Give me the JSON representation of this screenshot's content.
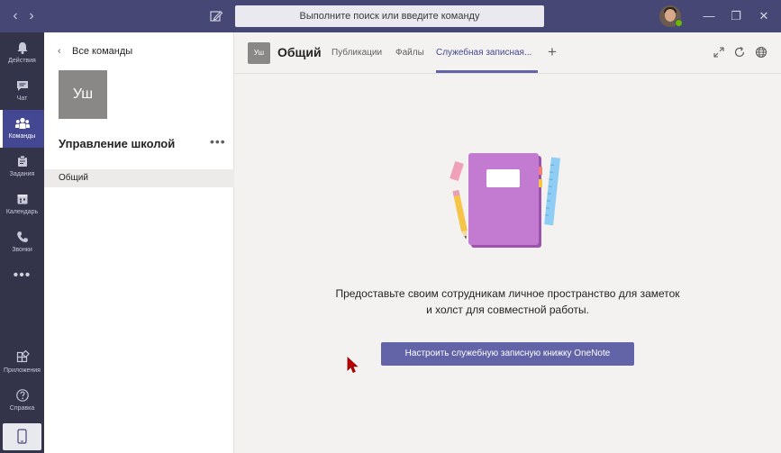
{
  "titlebar": {
    "search_placeholder": "Выполните поиск или введите команду",
    "back_arrow": "‹",
    "forward_arrow": "›",
    "minimize": "—",
    "restore": "❐",
    "close": "✕"
  },
  "rail": {
    "items": [
      {
        "label": "Действия",
        "icon": "bell-icon"
      },
      {
        "label": "Чат",
        "icon": "chat-icon"
      },
      {
        "label": "Команды",
        "icon": "teams-icon"
      },
      {
        "label": "Задания",
        "icon": "assignments-icon"
      },
      {
        "label": "Календарь",
        "icon": "calendar-icon"
      },
      {
        "label": "Звонки",
        "icon": "phone-icon"
      }
    ],
    "more": "•••",
    "apps_label": "Приложения",
    "help_label": "Справка",
    "active_index": 2
  },
  "panel": {
    "back_label": "Все команды",
    "team_initials": "Уш",
    "team_name": "Управление школой",
    "more": "•••",
    "channels": [
      "Общий"
    ]
  },
  "header": {
    "channel_initials": "Уш",
    "channel_name": "Общий",
    "tabs": [
      {
        "label": "Публикации"
      },
      {
        "label": "Файлы"
      },
      {
        "label": "Служебная записная..."
      }
    ],
    "add_tab": "+"
  },
  "content": {
    "message_line1": "Предоставьте своим сотрудникам личное пространство для заметок",
    "message_line2": "и холст для совместной работы.",
    "cta_label": "Настроить служебную записную книжку OneNote"
  },
  "colors": {
    "titlebar": "#464775",
    "rail": "#33344a",
    "accent": "#6264a7",
    "notebook": "#c27bd0"
  }
}
